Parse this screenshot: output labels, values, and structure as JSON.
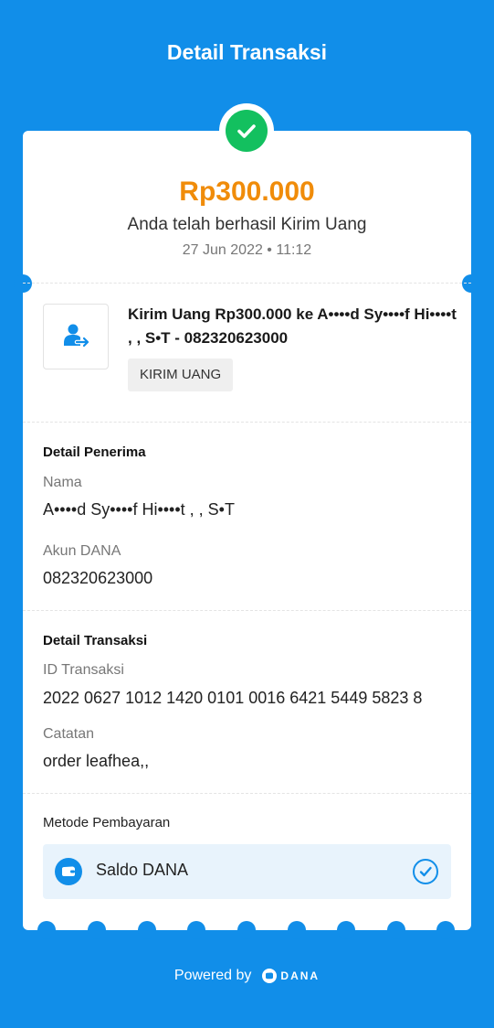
{
  "header": {
    "title": "Detail Transaksi"
  },
  "summary": {
    "amount": "Rp300.000",
    "status": "Anda telah berhasil Kirim Uang",
    "datetime": "27 Jun 2022 • 11:12"
  },
  "transaction": {
    "icon": "send-money-icon",
    "description": "Kirim Uang Rp300.000 ke A••••d Sy••••f Hi••••t , , S•T - 082320623000",
    "badge": "KIRIM UANG"
  },
  "recipient": {
    "section_title": "Detail Penerima",
    "name_label": "Nama",
    "name_value": "A••••d Sy••••f Hi••••t , , S•T",
    "account_label": "Akun DANA",
    "account_value": "082320623000"
  },
  "details": {
    "section_title": "Detail Transaksi",
    "id_label": "ID Transaksi",
    "id_value": "2022 0627 1012 1420 0101 0016 6421 5449 5823 8",
    "note_label": "Catatan",
    "note_value": "order leafhea,,"
  },
  "payment": {
    "label": "Metode Pembayaran",
    "method": "Saldo DANA",
    "method_icon": "wallet-icon",
    "selected_icon": "check-circle-icon"
  },
  "footer": {
    "powered_by": "Powered by",
    "brand": "DANA"
  },
  "colors": {
    "brand_blue": "#118ee9",
    "amount_orange": "#f08c0a",
    "success_green": "#13c05f",
    "method_bg": "#e8f3fc"
  }
}
